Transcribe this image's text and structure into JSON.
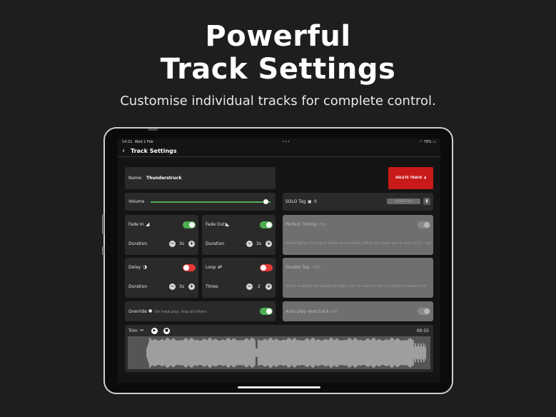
{
  "headline": {
    "line1": "Powerful",
    "line2": "Track Settings"
  },
  "subtitle": "Customise individual tracks for complete control.",
  "status_bar": {
    "time": "14:21",
    "date": "Wed 1 Feb",
    "dots": "•••",
    "battery": "78%"
  },
  "nav": {
    "back_icon": "chevron-left-icon",
    "title": "Track Settings"
  },
  "name_card": {
    "label": "Name:",
    "value": "Thunderstruck"
  },
  "delete_button": {
    "label": "DELETE TRACK",
    "icon": "trash-icon"
  },
  "volume": {
    "label": "Volume",
    "level": 0.96
  },
  "solo_tag": {
    "label": "SOLO Tag",
    "count": "0",
    "assign_label": "ASSIGN TAG"
  },
  "fade_in": {
    "label": "Fade In",
    "enabled": true,
    "duration_label": "Duration",
    "duration_value": "3s"
  },
  "fade_out": {
    "label": "Fade Out",
    "enabled": true,
    "duration_label": "Duration",
    "duration_value": "3s"
  },
  "delay": {
    "label": "Delay",
    "enabled": false,
    "duration_label": "Duration",
    "duration_value": "3s"
  },
  "loop": {
    "label": "Loop",
    "enabled": false,
    "times_label": "Times",
    "times_value": "2"
  },
  "perfect_timing": {
    "label": "Perfect Timing",
    "badge": "PRO",
    "desc": "When Perfect Timing & Delay are enabled, SOLO will count you in from 3,2,1 - Go!"
  },
  "double_tap": {
    "label": "Double Tap",
    "badge": "PRO",
    "desc": "When enabled, the assigned tag(s) can be used to start & stop the same track"
  },
  "auto_play": {
    "label": "Auto play next track",
    "badge": "PRO"
  },
  "override": {
    "label": "Override",
    "desc": "On track play, stop all others",
    "enabled": true
  },
  "trim": {
    "label": "Trim",
    "time": "00:15"
  },
  "colors": {
    "accent_green": "#4caf50",
    "delete_red": "#c91a1a",
    "toggle_off_red": "#e53935"
  }
}
